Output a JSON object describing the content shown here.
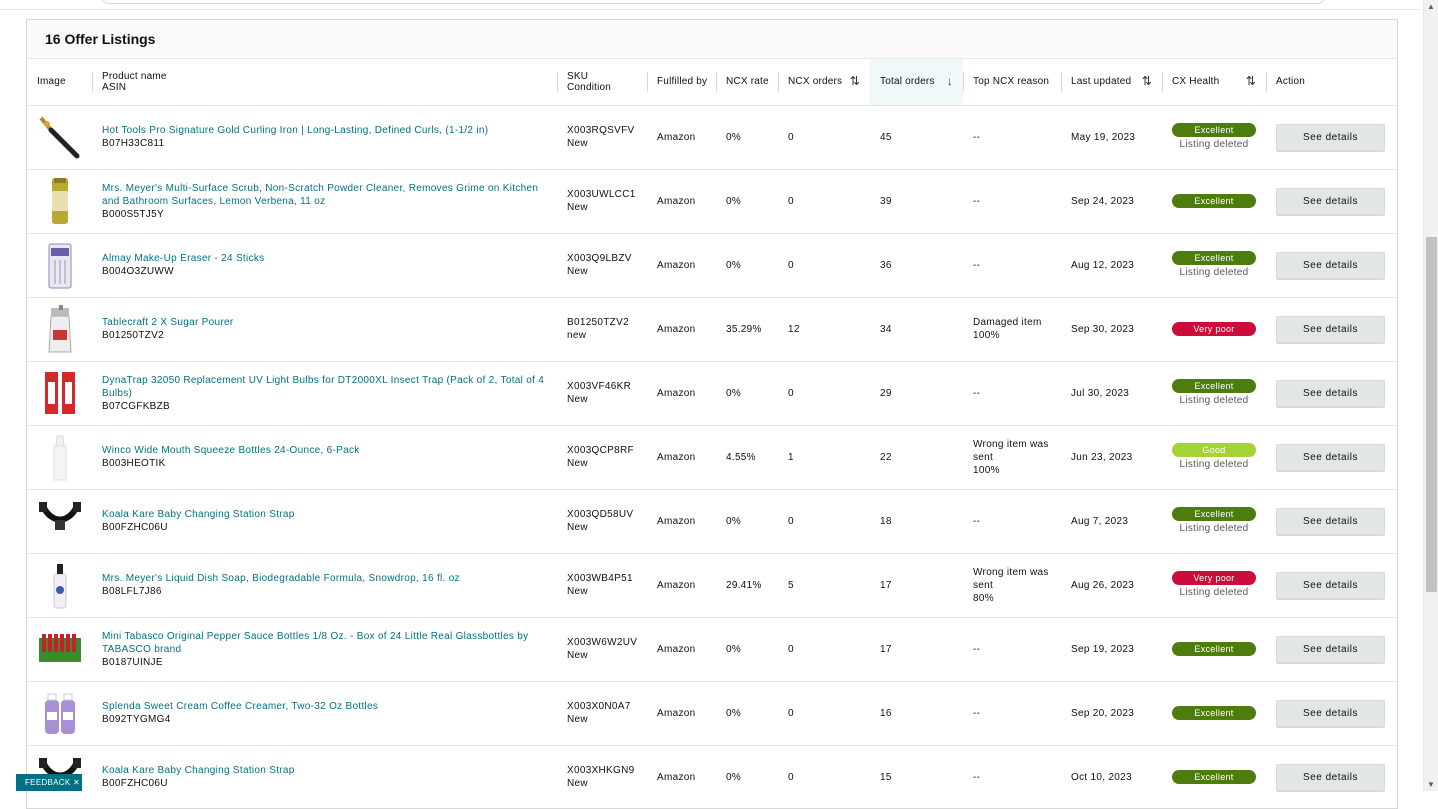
{
  "header": {
    "title": "16 Offer Listings"
  },
  "columns": {
    "image": "Image",
    "product_name": "Product name",
    "asin": "ASIN",
    "sku": "SKU",
    "condition": "Condition",
    "fulfilled_by": "Fulfilled by",
    "ncx_rate": "NCX rate",
    "ncx_orders": "NCX orders",
    "total_orders": "Total orders",
    "top_ncx_reason": "Top NCX reason",
    "last_updated": "Last updated",
    "cx_health": "CX Health",
    "action": "Action"
  },
  "rows": [
    {
      "name": "Hot Tools Pro Signature Gold Curling Iron | Long-Lasting, Defined Curls, (1-1/2 in)",
      "asin": "B07H33C811",
      "sku": "X003RQSVFV",
      "condition": "New",
      "fulfilled": "Amazon",
      "rate": "0%",
      "ncx": "0",
      "total": "45",
      "reason": "--",
      "reason2": "",
      "reason3": "",
      "updated": "May 19, 2023",
      "health": "Excellent",
      "health_sub": "Listing deleted",
      "action": "See details",
      "thumb": "curling-iron"
    },
    {
      "name": "Mrs. Meyer's Multi-Surface Scrub, Non-Scratch Powder Cleaner, Removes Grime on Kitchen and Bathroom Surfaces, Lemon Verbena, 11 oz",
      "asin": "B000S5TJ5Y",
      "sku": "X003UWLCC1",
      "condition": "New",
      "fulfilled": "Amazon",
      "rate": "0%",
      "ncx": "0",
      "total": "39",
      "reason": "--",
      "reason2": "",
      "reason3": "",
      "updated": "Sep 24, 2023",
      "health": "Excellent",
      "health_sub": "",
      "action": "See details",
      "thumb": "scrub-can"
    },
    {
      "name": "Almay Make-Up Eraser - 24 Sticks",
      "asin": "B004O3ZUWW",
      "sku": "X003Q9LBZV",
      "condition": "New",
      "fulfilled": "Amazon",
      "rate": "0%",
      "ncx": "0",
      "total": "36",
      "reason": "--",
      "reason2": "",
      "reason3": "",
      "updated": "Aug 12, 2023",
      "health": "Excellent",
      "health_sub": "Listing deleted",
      "action": "See details",
      "thumb": "eraser-pack"
    },
    {
      "name": "Tablecraft 2 X Sugar Pourer",
      "asin": "B01250TZV2",
      "sku": "B01250TZV2",
      "condition": "new",
      "fulfilled": "Amazon",
      "rate": "35.29%",
      "ncx": "12",
      "total": "34",
      "reason": "Damaged item",
      "reason2": "100%",
      "reason3": "",
      "updated": "Sep 30, 2023",
      "health": "Very poor",
      "health_sub": "",
      "action": "See details",
      "thumb": "sugar-pourer"
    },
    {
      "name": "DynaTrap 32050 Replacement UV Light Bulbs for DT2000XL Insect Trap (Pack of 2, Total of 4 Bulbs)",
      "asin": "B07CGFKBZB",
      "sku": "X003VF46KR",
      "condition": "New",
      "fulfilled": "Amazon",
      "rate": "0%",
      "ncx": "0",
      "total": "29",
      "reason": "--",
      "reason2": "",
      "reason3": "",
      "updated": "Jul 30, 2023",
      "health": "Excellent",
      "health_sub": "Listing deleted",
      "action": "See details",
      "thumb": "uv-bulbs"
    },
    {
      "name": "Winco Wide Mouth Squeeze Bottles 24-Ounce, 6-Pack",
      "asin": "B003HEOTIK",
      "sku": "X003QCP8RF",
      "condition": "New",
      "fulfilled": "Amazon",
      "rate": "4.55%",
      "ncx": "1",
      "total": "22",
      "reason": "Wrong item was",
      "reason2": "sent",
      "reason3": "100%",
      "updated": "Jun 23, 2023",
      "health": "Good",
      "health_sub": "Listing deleted",
      "action": "See details",
      "thumb": "squeeze-bottle"
    },
    {
      "name": "Koala Kare Baby Changing Station Strap",
      "asin": "B00FZHC06U",
      "sku": "X003QD58UV",
      "condition": "New",
      "fulfilled": "Amazon",
      "rate": "0%",
      "ncx": "0",
      "total": "18",
      "reason": "--",
      "reason2": "",
      "reason3": "",
      "updated": "Aug 7, 2023",
      "health": "Excellent",
      "health_sub": "Listing deleted",
      "action": "See details",
      "thumb": "strap"
    },
    {
      "name": "Mrs. Meyer's Liquid Dish Soap, Biodegradable Formula, Snowdrop, 16 fl. oz",
      "asin": "B08LFL7J86",
      "sku": "X003WB4P51",
      "condition": "New",
      "fulfilled": "Amazon",
      "rate": "29.41%",
      "ncx": "5",
      "total": "17",
      "reason": "Wrong item was",
      "reason2": "sent",
      "reason3": "80%",
      "updated": "Aug 26, 2023",
      "health": "Very poor",
      "health_sub": "Listing deleted",
      "action": "See details",
      "thumb": "dish-soap"
    },
    {
      "name": "Mini Tabasco Original Pepper Sauce Bottles 1/8 Oz. - Box of 24 Little Real Glassbottles by TABASCO brand",
      "asin": "B0187UINJE",
      "sku": "X003W6W2UV",
      "condition": "New",
      "fulfilled": "Amazon",
      "rate": "0%",
      "ncx": "0",
      "total": "17",
      "reason": "--",
      "reason2": "",
      "reason3": "",
      "updated": "Sep 19, 2023",
      "health": "Excellent",
      "health_sub": "",
      "action": "See details",
      "thumb": "tabasco-box"
    },
    {
      "name": "Splenda Sweet Cream Coffee Creamer, Two-32 Oz Bottles",
      "asin": "B092TYGMG4",
      "sku": "X003X0N0A7",
      "condition": "New",
      "fulfilled": "Amazon",
      "rate": "0%",
      "ncx": "0",
      "total": "16",
      "reason": "--",
      "reason2": "",
      "reason3": "",
      "updated": "Sep 20, 2023",
      "health": "Excellent",
      "health_sub": "",
      "action": "See details",
      "thumb": "creamer-bottles"
    },
    {
      "name": "Koala Kare Baby Changing Station Strap",
      "asin": "B00FZHC06U",
      "sku": "X003XHKGN9",
      "condition": "New",
      "fulfilled": "Amazon",
      "rate": "0%",
      "ncx": "0",
      "total": "15",
      "reason": "--",
      "reason2": "",
      "reason3": "",
      "updated": "Oct 10, 2023",
      "health": "Excellent",
      "health_sub": "",
      "action": "See details",
      "thumb": "strap"
    }
  ],
  "feedback": {
    "label": "FEEDBACK ✕"
  },
  "colors": {
    "link": "#007185",
    "excellent": "#4d7c0f",
    "very_poor": "#cc0c39",
    "good": "#a3d334"
  }
}
